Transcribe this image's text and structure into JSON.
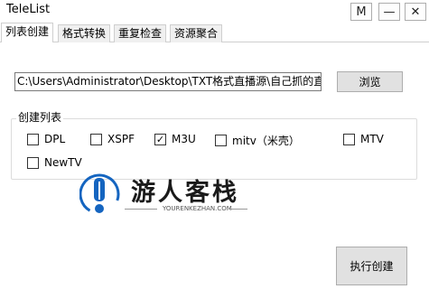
{
  "window": {
    "title": "TeleList",
    "btn_m": "M",
    "btn_min": "—",
    "btn_close": "✕"
  },
  "tabs": [
    {
      "label": "列表创建",
      "active": true
    },
    {
      "label": "格式转换",
      "active": false
    },
    {
      "label": "重复检查",
      "active": false
    },
    {
      "label": "资源聚合",
      "active": false
    }
  ],
  "path": {
    "value": "C:\\Users\\Administrator\\Desktop\\TXT格式直播源\\自己抓的直",
    "browse_label": "浏览"
  },
  "create_list": {
    "title": "创建列表",
    "options": [
      {
        "label": "DPL",
        "checked": false
      },
      {
        "label": "XSPF",
        "checked": false
      },
      {
        "label": "M3U",
        "checked": true
      },
      {
        "label": "mitv（米壳）",
        "checked": false
      },
      {
        "label": "MTV",
        "checked": false
      },
      {
        "label": "NewTV",
        "checked": false
      }
    ]
  },
  "watermark": {
    "name": "游人客栈",
    "url": "YOURENKEZHAN.COM"
  },
  "actions": {
    "execute_label": "执行创建"
  }
}
